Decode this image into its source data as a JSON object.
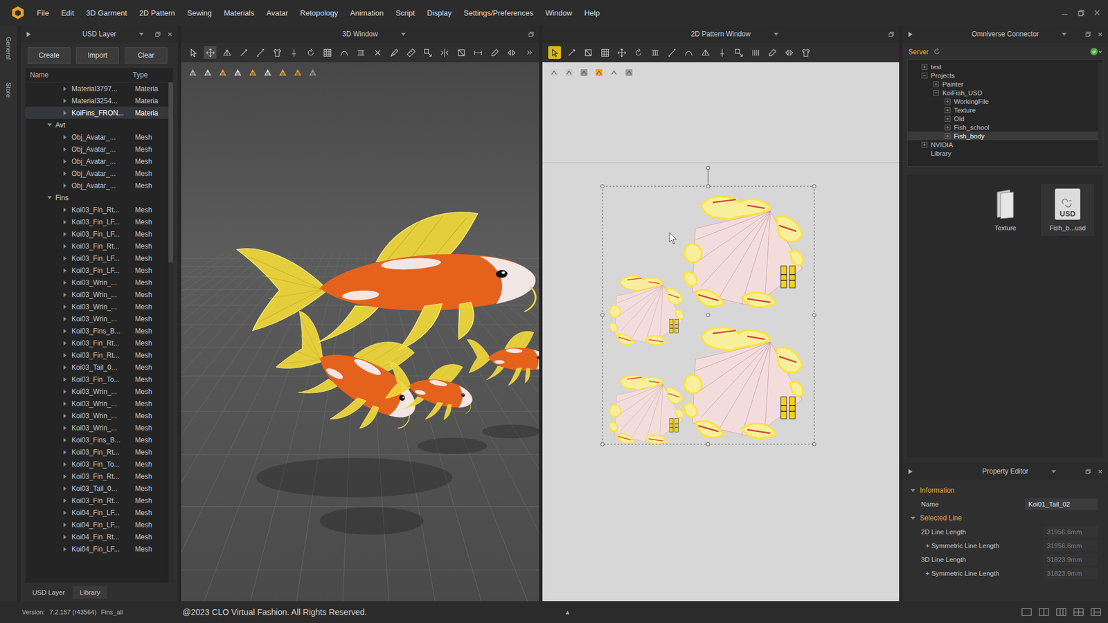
{
  "menu": [
    "File",
    "Edit",
    "3D Garment",
    "2D Pattern",
    "Sewing",
    "Materials",
    "Avatar",
    "Retopology",
    "Animation",
    "Script",
    "Display",
    "Settings/Preferences",
    "Window",
    "Help"
  ],
  "side_tabs": [
    "General",
    "Store"
  ],
  "usd_layer": {
    "title": "USD Layer",
    "buttons": [
      "Create",
      "Import",
      "Clear"
    ],
    "columns": [
      "Name",
      "Type"
    ],
    "scrollbar_level": 0.36,
    "rows": [
      {
        "name": "Material3797...",
        "type": "Materia",
        "depth": 2,
        "has_children": true,
        "expanded": false,
        "selected": false
      },
      {
        "name": "Material3254...",
        "type": "Materia",
        "depth": 2,
        "has_children": true,
        "expanded": false,
        "selected": false
      },
      {
        "name": "KoiFins_FRON...",
        "type": "Materia",
        "depth": 2,
        "has_children": true,
        "expanded": false,
        "selected": true
      },
      {
        "name": "Avt",
        "type": "",
        "depth": 1,
        "has_children": true,
        "expanded": true,
        "selected": false
      },
      {
        "name": "Obj_Avatar_...",
        "type": "Mesh",
        "depth": 2,
        "has_children": true,
        "expanded": false,
        "selected": false
      },
      {
        "name": "Obj_Avatar_...",
        "type": "Mesh",
        "depth": 2,
        "has_children": true,
        "expanded": false,
        "selected": false
      },
      {
        "name": "Obj_Avatar_...",
        "type": "Mesh",
        "depth": 2,
        "has_children": true,
        "expanded": false,
        "selected": false
      },
      {
        "name": "Obj_Avatar_...",
        "type": "Mesh",
        "depth": 2,
        "has_children": true,
        "expanded": false,
        "selected": false
      },
      {
        "name": "Obj_Avatar_...",
        "type": "Mesh",
        "depth": 2,
        "has_children": true,
        "expanded": false,
        "selected": false
      },
      {
        "name": "Fins",
        "type": "",
        "depth": 1,
        "has_children": true,
        "expanded": true,
        "selected": false
      },
      {
        "name": "Koi03_Fin_Rt...",
        "type": "Mesh",
        "depth": 2,
        "has_children": true,
        "expanded": false,
        "selected": false
      },
      {
        "name": "Koi03_Fin_LF...",
        "type": "Mesh",
        "depth": 2,
        "has_children": true,
        "expanded": false,
        "selected": false
      },
      {
        "name": "Koi03_Fin_LF...",
        "type": "Mesh",
        "depth": 2,
        "has_children": true,
        "expanded": false,
        "selected": false
      },
      {
        "name": "Koi03_Fin_Rt...",
        "type": "Mesh",
        "depth": 2,
        "has_children": true,
        "expanded": false,
        "selected": false
      },
      {
        "name": "Koi03_Fin_LF...",
        "type": "Mesh",
        "depth": 2,
        "has_children": true,
        "expanded": false,
        "selected": false
      },
      {
        "name": "Koi03_Fin_LF...",
        "type": "Mesh",
        "depth": 2,
        "has_children": true,
        "expanded": false,
        "selected": false
      },
      {
        "name": "Koi03_Wrin_...",
        "type": "Mesh",
        "depth": 2,
        "has_children": true,
        "expanded": false,
        "selected": false
      },
      {
        "name": "Koi03_Wrin_...",
        "type": "Mesh",
        "depth": 2,
        "has_children": true,
        "expanded": false,
        "selected": false
      },
      {
        "name": "Koi03_Wrin_...",
        "type": "Mesh",
        "depth": 2,
        "has_children": true,
        "expanded": false,
        "selected": false
      },
      {
        "name": "Koi03_Wrin_...",
        "type": "Mesh",
        "depth": 2,
        "has_children": true,
        "expanded": false,
        "selected": false
      },
      {
        "name": "Koi03_Fins_B...",
        "type": "Mesh",
        "depth": 2,
        "has_children": true,
        "expanded": false,
        "selected": false
      },
      {
        "name": "Koi03_Fin_Rt...",
        "type": "Mesh",
        "depth": 2,
        "has_children": true,
        "expanded": false,
        "selected": false
      },
      {
        "name": "Koi03_Fin_Rt...",
        "type": "Mesh",
        "depth": 2,
        "has_children": true,
        "expanded": false,
        "selected": false
      },
      {
        "name": "Koi03_Tail_0...",
        "type": "Mesh",
        "depth": 2,
        "has_children": true,
        "expanded": false,
        "selected": false
      },
      {
        "name": "Koi03_Fin_To...",
        "type": "Mesh",
        "depth": 2,
        "has_children": true,
        "expanded": false,
        "selected": false
      },
      {
        "name": "Koi03_Wrin_...",
        "type": "Mesh",
        "depth": 2,
        "has_children": true,
        "expanded": false,
        "selected": false
      },
      {
        "name": "Koi03_Wrin_...",
        "type": "Mesh",
        "depth": 2,
        "has_children": true,
        "expanded": false,
        "selected": false
      },
      {
        "name": "Koi03_Wrin_...",
        "type": "Mesh",
        "depth": 2,
        "has_children": true,
        "expanded": false,
        "selected": false
      },
      {
        "name": "Koi03_Wrin_...",
        "type": "Mesh",
        "depth": 2,
        "has_children": true,
        "expanded": false,
        "selected": false
      },
      {
        "name": "Koi03_Fins_B...",
        "type": "Mesh",
        "depth": 2,
        "has_children": true,
        "expanded": false,
        "selected": false
      },
      {
        "name": "Koi03_Fin_Rt...",
        "type": "Mesh",
        "depth": 2,
        "has_children": true,
        "expanded": false,
        "selected": false
      },
      {
        "name": "Koi03_Fin_To...",
        "type": "Mesh",
        "depth": 2,
        "has_children": true,
        "expanded": false,
        "selected": false
      },
      {
        "name": "Koi03_Fin_Rt...",
        "type": "Mesh",
        "depth": 2,
        "has_children": true,
        "expanded": false,
        "selected": false
      },
      {
        "name": "Koi03_Tail_0...",
        "type": "Mesh",
        "depth": 2,
        "has_children": true,
        "expanded": false,
        "selected": false
      },
      {
        "name": "Koi03_Fin_Rt...",
        "type": "Mesh",
        "depth": 2,
        "has_children": true,
        "expanded": false,
        "selected": false
      },
      {
        "name": "Koi04_Fin_LF...",
        "type": "Mesh",
        "depth": 2,
        "has_children": true,
        "expanded": false,
        "selected": false
      },
      {
        "name": "Koi04_Fin_LF...",
        "type": "Mesh",
        "depth": 2,
        "has_children": true,
        "expanded": false,
        "selected": false
      },
      {
        "name": "Koi04_Fin_Rt...",
        "type": "Mesh",
        "depth": 2,
        "has_children": true,
        "expanded": false,
        "selected": false
      },
      {
        "name": "Koi04_Fin_LF...",
        "type": "Mesh",
        "depth": 2,
        "has_children": true,
        "expanded": false,
        "selected": false
      }
    ],
    "tabs": [
      {
        "label": "USD Layer",
        "selected": true
      },
      {
        "label": "Library",
        "selected": false
      }
    ]
  },
  "window_3d": {
    "title": "3D Window",
    "tools": [
      {
        "selected": false
      },
      {
        "selected": true
      },
      {
        "selected": false
      },
      {
        "selected": false
      },
      {
        "selected": false
      },
      {
        "selected": false
      },
      {
        "selected": false
      },
      {
        "selected": false
      },
      {
        "selected": false
      },
      {
        "selected": false
      },
      {
        "selected": false
      },
      {
        "selected": false
      },
      {
        "selected": false
      },
      {
        "selected": false
      },
      {
        "selected": false
      },
      {
        "selected": false
      },
      {
        "selected": false
      },
      {
        "selected": false
      },
      {
        "selected": false
      },
      {
        "selected": false
      }
    ]
  },
  "window_2d": {
    "title": "2D Pattern Window",
    "tools": [
      {
        "selected": true
      },
      {
        "selected": false
      },
      {
        "selected": false
      },
      {
        "selected": false
      },
      {
        "selected": false
      },
      {
        "selected": false
      },
      {
        "selected": false
      },
      {
        "selected": false
      },
      {
        "selected": false
      },
      {
        "selected": false
      },
      {
        "selected": false
      },
      {
        "selected": false
      },
      {
        "selected": false
      },
      {
        "selected": false
      },
      {
        "selected": false
      },
      {
        "selected": false
      }
    ]
  },
  "omniverse": {
    "title": "Omniverse Connector",
    "server_label": "Server",
    "connected": true,
    "tree": [
      {
        "name": "test",
        "depth": 0,
        "has_children": true,
        "expanded": false,
        "selected": false
      },
      {
        "name": "Projects",
        "depth": 0,
        "has_children": true,
        "expanded": true,
        "selected": false
      },
      {
        "name": "Painter",
        "depth": 1,
        "has_children": true,
        "expanded": false,
        "selected": false
      },
      {
        "name": "KoiFish_USD",
        "depth": 1,
        "has_children": true,
        "expanded": true,
        "selected": false
      },
      {
        "name": "WorkingFile",
        "depth": 2,
        "has_children": true,
        "expanded": false,
        "selected": false
      },
      {
        "name": "Texture",
        "depth": 2,
        "has_children": true,
        "expanded": false,
        "selected": false
      },
      {
        "name": "Old",
        "depth": 2,
        "has_children": true,
        "expanded": false,
        "selected": false
      },
      {
        "name": "Fish_school",
        "depth": 2,
        "has_children": true,
        "expanded": false,
        "selected": false
      },
      {
        "name": "Fish_body",
        "depth": 2,
        "has_children": true,
        "expanded": false,
        "selected": true
      },
      {
        "name": "NVIDIA",
        "depth": 0,
        "has_children": true,
        "expanded": false,
        "selected": false
      },
      {
        "name": "Library",
        "depth": 0,
        "has_children": false,
        "expanded": false,
        "selected": false
      }
    ],
    "files": [
      {
        "name": "Texture",
        "kind": "folder",
        "badge": "",
        "selected": false
      },
      {
        "name": "Fish_b...usd",
        "kind": "usd",
        "badge": "USD",
        "selected": true
      }
    ]
  },
  "property_editor": {
    "title": "Property Editor",
    "sections": [
      {
        "title": "Information",
        "expanded": true,
        "rows": [
          {
            "label": "Name",
            "value": "Koi01_Tail_02",
            "disabled": false,
            "sub": false
          }
        ]
      },
      {
        "title": "Selected Line",
        "expanded": true,
        "rows": [
          {
            "label": "2D Line Length",
            "value": "31956.6mm",
            "disabled": true,
            "sub": false
          },
          {
            "label": "+ Symmetric Line Length",
            "value": "31956.6mm",
            "disabled": true,
            "sub": true
          },
          {
            "label": "3D Line Length",
            "value": "31823.9mm",
            "disabled": true,
            "sub": false
          },
          {
            "label": "+ Symmetric Line Length",
            "value": "31823.9mm",
            "disabled": true,
            "sub": true
          }
        ]
      }
    ]
  },
  "status_bar": {
    "version_label": "Version:",
    "version": "7.2.157 (r43564)",
    "file": "Fins_all",
    "copyright": "@2023 CLO Virtual Fashion. All Rights Reserved.",
    "toggle": "▲"
  }
}
